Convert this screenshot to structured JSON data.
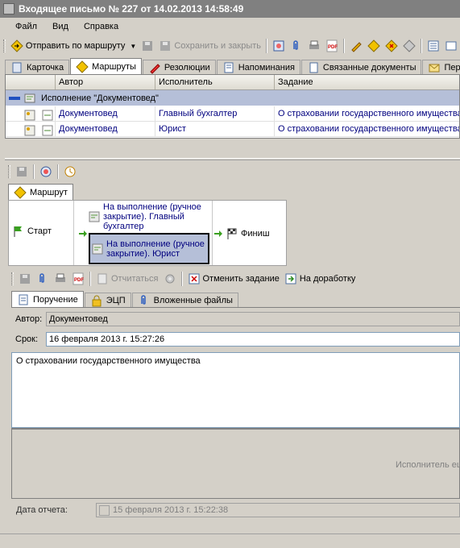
{
  "window": {
    "title": "Входящее письмо № 227 от 14.02.2013 14:58:49"
  },
  "menu": [
    "Файл",
    "Вид",
    "Справка"
  ],
  "toolbar": {
    "send_route": "Отправить по маршруту",
    "save_close": "Сохранить и закрыть"
  },
  "tabs": [
    "Карточка",
    "Маршруты",
    "Резолюции",
    "Напоминания",
    "Связанные документы",
    "Пере"
  ],
  "grid": {
    "columns": [
      "Автор",
      "Исполнитель",
      "Задание"
    ],
    "group_label": "Исполнение \"Документовед\"",
    "rows": [
      {
        "author": "Документовед",
        "executor": "Главный бухгалтер",
        "task": "О страховании государственного имущества"
      },
      {
        "author": "Документовед",
        "executor": "Юрист",
        "task": "О страховании государственного имущества"
      }
    ]
  },
  "route_tab": "Маршрут",
  "route": {
    "start": "Старт",
    "step1": "На выполнение (ручное закрытие). Главный бухгалтер",
    "step2": "На выполнение (ручное закрытие). Юрист",
    "finish": "Финиш"
  },
  "task_toolbar": {
    "report": "Отчитаться",
    "cancel": "Отменить задание",
    "rework": "На доработку"
  },
  "inner_tabs": [
    "Поручение",
    "ЭЦП",
    "Вложенные файлы"
  ],
  "form": {
    "author_label": "Автор:",
    "author_value": "Документовед",
    "deadline_label": "Срок:",
    "deadline_value": "16 февраля  2013 г. 15:27:26",
    "body_text": "О страховании государственного имущества",
    "executor_note": "Исполнитель еш",
    "report_date_label": "Дата отчета:",
    "report_date_value": "15 февраля  2013 г. 15:22:38"
  },
  "colors": {
    "title_bg": "#808080",
    "selection": "#b5bfd8",
    "link": "#00007f",
    "accent": "#0a246a"
  }
}
